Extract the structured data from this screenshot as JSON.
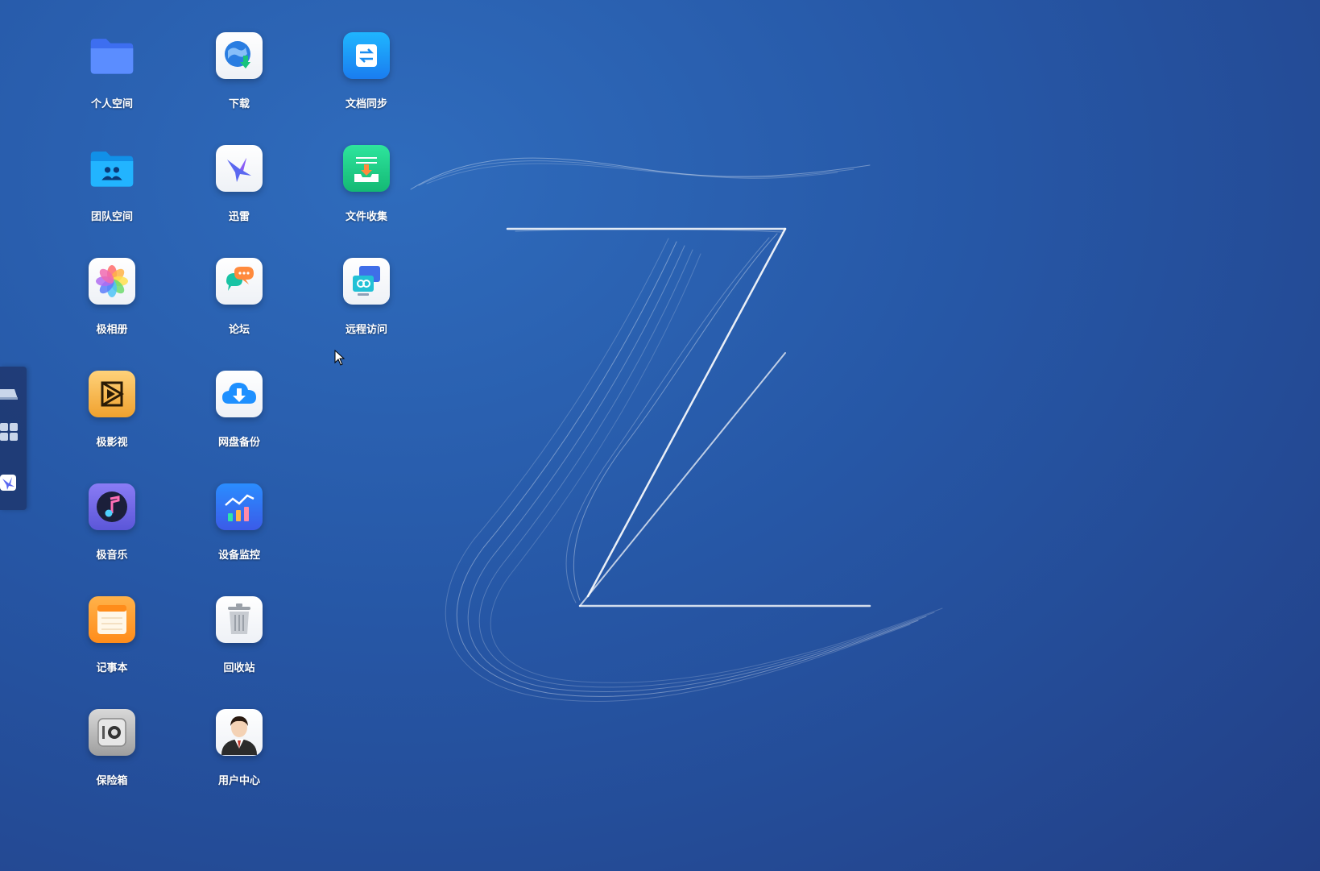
{
  "desktop": {
    "apps": [
      {
        "id": "personal-space",
        "label": "个人空间",
        "icon": "folder-icon"
      },
      {
        "id": "download",
        "label": "下载",
        "icon": "globe-download-icon"
      },
      {
        "id": "doc-sync",
        "label": "文档同步",
        "icon": "sync-arrows-icon"
      },
      {
        "id": "team-space",
        "label": "团队空间",
        "icon": "team-folder-icon"
      },
      {
        "id": "xunlei",
        "label": "迅雷",
        "icon": "bird-icon"
      },
      {
        "id": "file-collect",
        "label": "文件收集",
        "icon": "inbox-tray-icon"
      },
      {
        "id": "photo-album",
        "label": "极相册",
        "icon": "flower-icon"
      },
      {
        "id": "forum",
        "label": "论坛",
        "icon": "chat-bubbles-icon"
      },
      {
        "id": "remote-access",
        "label": "远程访问",
        "icon": "remote-link-icon"
      },
      {
        "id": "video",
        "label": "极影视",
        "icon": "film-icon"
      },
      {
        "id": "cloud-backup",
        "label": "网盘备份",
        "icon": "cloud-download-icon"
      },
      {
        "id": "music",
        "label": "极音乐",
        "icon": "music-note-icon"
      },
      {
        "id": "device-monitor",
        "label": "设备监控",
        "icon": "bar-chart-icon"
      },
      {
        "id": "notepad",
        "label": "记事本",
        "icon": "notepad-icon"
      },
      {
        "id": "recycle-bin",
        "label": "回收站",
        "icon": "trash-icon"
      },
      {
        "id": "safe-box",
        "label": "保险箱",
        "icon": "safe-icon"
      },
      {
        "id": "user-center",
        "label": "用户中心",
        "icon": "user-avatar-icon"
      }
    ]
  },
  "dock": {
    "items": [
      {
        "id": "storage",
        "icon": "drive-icon"
      },
      {
        "id": "apps",
        "icon": "grid-icon"
      },
      {
        "id": "xunlei",
        "icon": "bird-icon"
      }
    ]
  },
  "colors": {
    "wallpaper_light": "#2f6cbd",
    "wallpaper_dark": "#223f86",
    "dock_bg": "#1e376e"
  }
}
